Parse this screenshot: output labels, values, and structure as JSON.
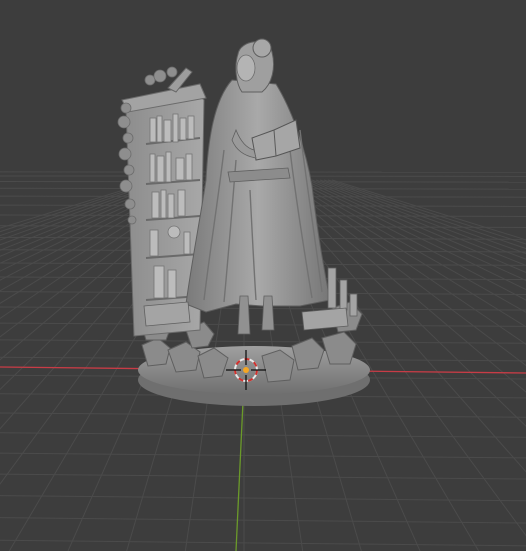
{
  "viewport": {
    "view_mode": "solid",
    "background_color": "#3d3d3d",
    "grid_color": "#4b4b4b",
    "x_axis_color": "#c83c46",
    "y_axis_color": "#6b9a2a",
    "model_color": "#9a9a9a",
    "model_shadow_color": "#6e6e6e",
    "model_highlight_color": "#bdbdbd",
    "cursor_outer_color": "#e8e8e8",
    "cursor_dash_color": "#d0312d",
    "origin_color": "#f5a623"
  },
  "scene": {
    "objects": [
      {
        "name_hint": "figurine-woman-with-book",
        "parts": [
          "bookshelf",
          "standing-woman",
          "open-book",
          "candles",
          "round-base"
        ]
      }
    ],
    "cursor_icon": "3d-cursor-icon",
    "origin_icon": "object-origin-icon"
  }
}
